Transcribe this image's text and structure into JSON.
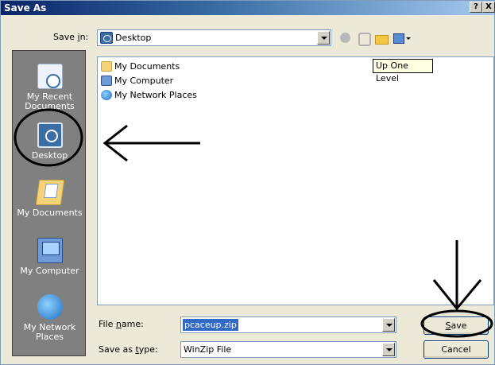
{
  "window": {
    "title": "Save As",
    "help_glyph": "?",
    "close_glyph": "X"
  },
  "toolbar": {
    "save_in_label": "Save in:",
    "save_in_value": "Desktop",
    "tooltip": "Up One Level"
  },
  "places": [
    {
      "label": "My Recent Documents",
      "icon": "recent-documents-icon"
    },
    {
      "label": "Desktop",
      "icon": "desktop-icon"
    },
    {
      "label": "My Documents",
      "icon": "my-documents-icon"
    },
    {
      "label": "My Computer",
      "icon": "my-computer-icon"
    },
    {
      "label": "My Network Places",
      "icon": "network-places-icon"
    }
  ],
  "files": [
    {
      "name": "My Documents",
      "icon": "folder-icon"
    },
    {
      "name": "My Computer",
      "icon": "computer-icon"
    },
    {
      "name": "My Network Places",
      "icon": "network-icon"
    }
  ],
  "form": {
    "file_name_label": "File name:",
    "file_name_value": "pcaceup.zip",
    "save_as_type_label": "Save as type:",
    "save_as_type_value": "WinZip File"
  },
  "buttons": {
    "save": "Save",
    "cancel": "Cancel"
  },
  "colors": {
    "title_gradient_start": "#0a246a",
    "places_bar": "#808080",
    "selection": "#316ac5",
    "annotation": "#000000"
  }
}
